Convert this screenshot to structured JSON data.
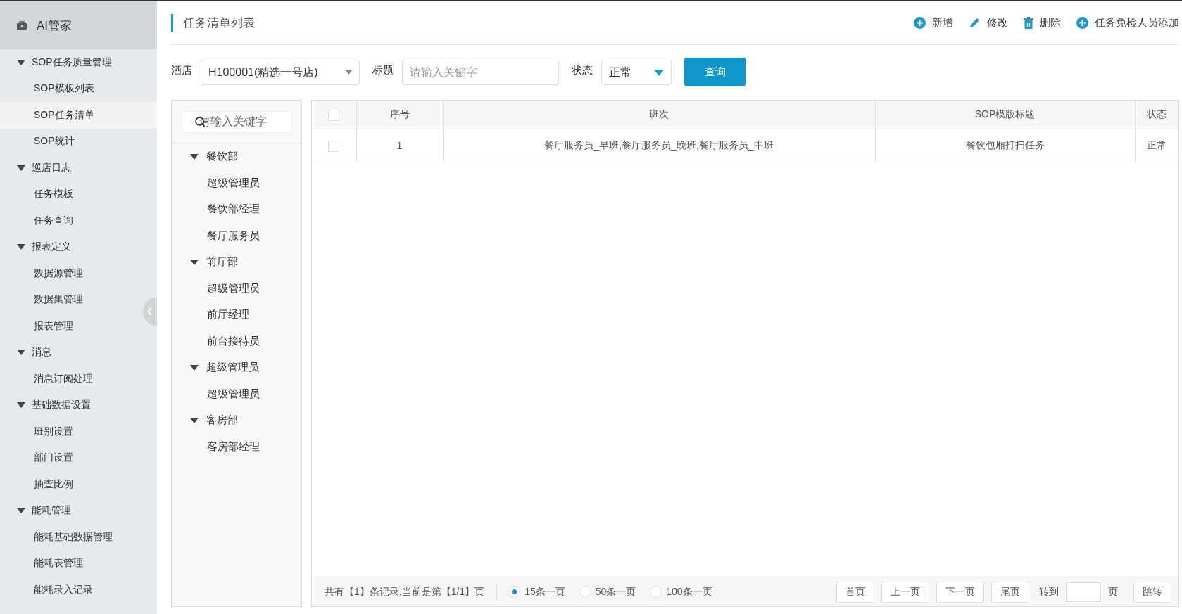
{
  "sidebar": {
    "title": "AI管家",
    "groups": [
      {
        "label": "SOP任务质量管理",
        "expanded": true,
        "items": [
          {
            "label": "SOP模板列表",
            "selected": false
          },
          {
            "label": "SOP任务清单",
            "selected": true
          },
          {
            "label": "SOP统计",
            "selected": false
          }
        ]
      },
      {
        "label": "巡店日志",
        "expanded": true,
        "items": [
          {
            "label": "任务模板",
            "selected": false
          },
          {
            "label": "任务查询",
            "selected": false
          }
        ]
      },
      {
        "label": "报表定义",
        "expanded": true,
        "items": [
          {
            "label": "数据源管理",
            "selected": false
          },
          {
            "label": "数据集管理",
            "selected": false
          },
          {
            "label": "报表管理",
            "selected": false
          }
        ]
      },
      {
        "label": "消息",
        "expanded": true,
        "items": [
          {
            "label": "消息订阅处理",
            "selected": false
          }
        ]
      },
      {
        "label": "基础数据设置",
        "expanded": true,
        "items": [
          {
            "label": "班别设置",
            "selected": false
          },
          {
            "label": "部门设置",
            "selected": false
          },
          {
            "label": "抽查比例",
            "selected": false
          }
        ]
      },
      {
        "label": "能耗管理",
        "expanded": true,
        "items": [
          {
            "label": "能耗基础数据管理",
            "selected": false
          },
          {
            "label": "能耗表管理",
            "selected": false
          },
          {
            "label": "能耗录入记录",
            "selected": false
          }
        ]
      }
    ]
  },
  "page_title": "任务清单列表",
  "toolbar": [
    {
      "kind": "add",
      "label": "新增"
    },
    {
      "kind": "edit",
      "label": "修改"
    },
    {
      "kind": "delete",
      "label": "删除"
    },
    {
      "kind": "add",
      "label": "任务免检人员添加"
    }
  ],
  "filters": {
    "hotel_label": "酒店",
    "hotel_value": "H100001(精选一号店)",
    "title_label": "标题",
    "title_placeholder": "请输入关键字",
    "status_label": "状态",
    "status_value": "正常",
    "query_button": "查询"
  },
  "tree": {
    "search_placeholder": "请输入关键字",
    "nodes": [
      {
        "label": "餐饮部",
        "expanded": true,
        "children": [
          {
            "label": "超级管理员"
          },
          {
            "label": "餐饮部经理"
          },
          {
            "label": "餐厅服务员"
          }
        ]
      },
      {
        "label": "前厅部",
        "expanded": true,
        "children": [
          {
            "label": "超级管理员"
          },
          {
            "label": "前厅经理"
          },
          {
            "label": "前台接待员"
          }
        ]
      },
      {
        "label": "超级管理员",
        "expanded": true,
        "children": [
          {
            "label": "超级管理员"
          }
        ]
      },
      {
        "label": "客房部",
        "expanded": true,
        "children": [
          {
            "label": "客房部经理"
          }
        ]
      }
    ]
  },
  "table": {
    "columns": [
      "序号",
      "班次",
      "SOP模版标题",
      "状态"
    ],
    "all_checked": false,
    "rows": [
      {
        "checked": false,
        "cells": [
          "1",
          "餐厅服务员_早班,餐厅服务员_晚班,餐厅服务员_中班",
          "餐饮包厢打扫任务",
          "正常"
        ]
      }
    ]
  },
  "pager": {
    "summary": "共有【1】条记录,当前是第【1/1】页",
    "page_sizes": [
      {
        "label": "15条一页",
        "selected": true
      },
      {
        "label": "50条一页",
        "selected": false
      },
      {
        "label": "100条一页",
        "selected": false
      }
    ],
    "buttons": [
      "首页",
      "上一页",
      "下一页",
      "尾页"
    ],
    "goto_label": "转到",
    "page_unit": "页",
    "jump_button": "跳转"
  }
}
